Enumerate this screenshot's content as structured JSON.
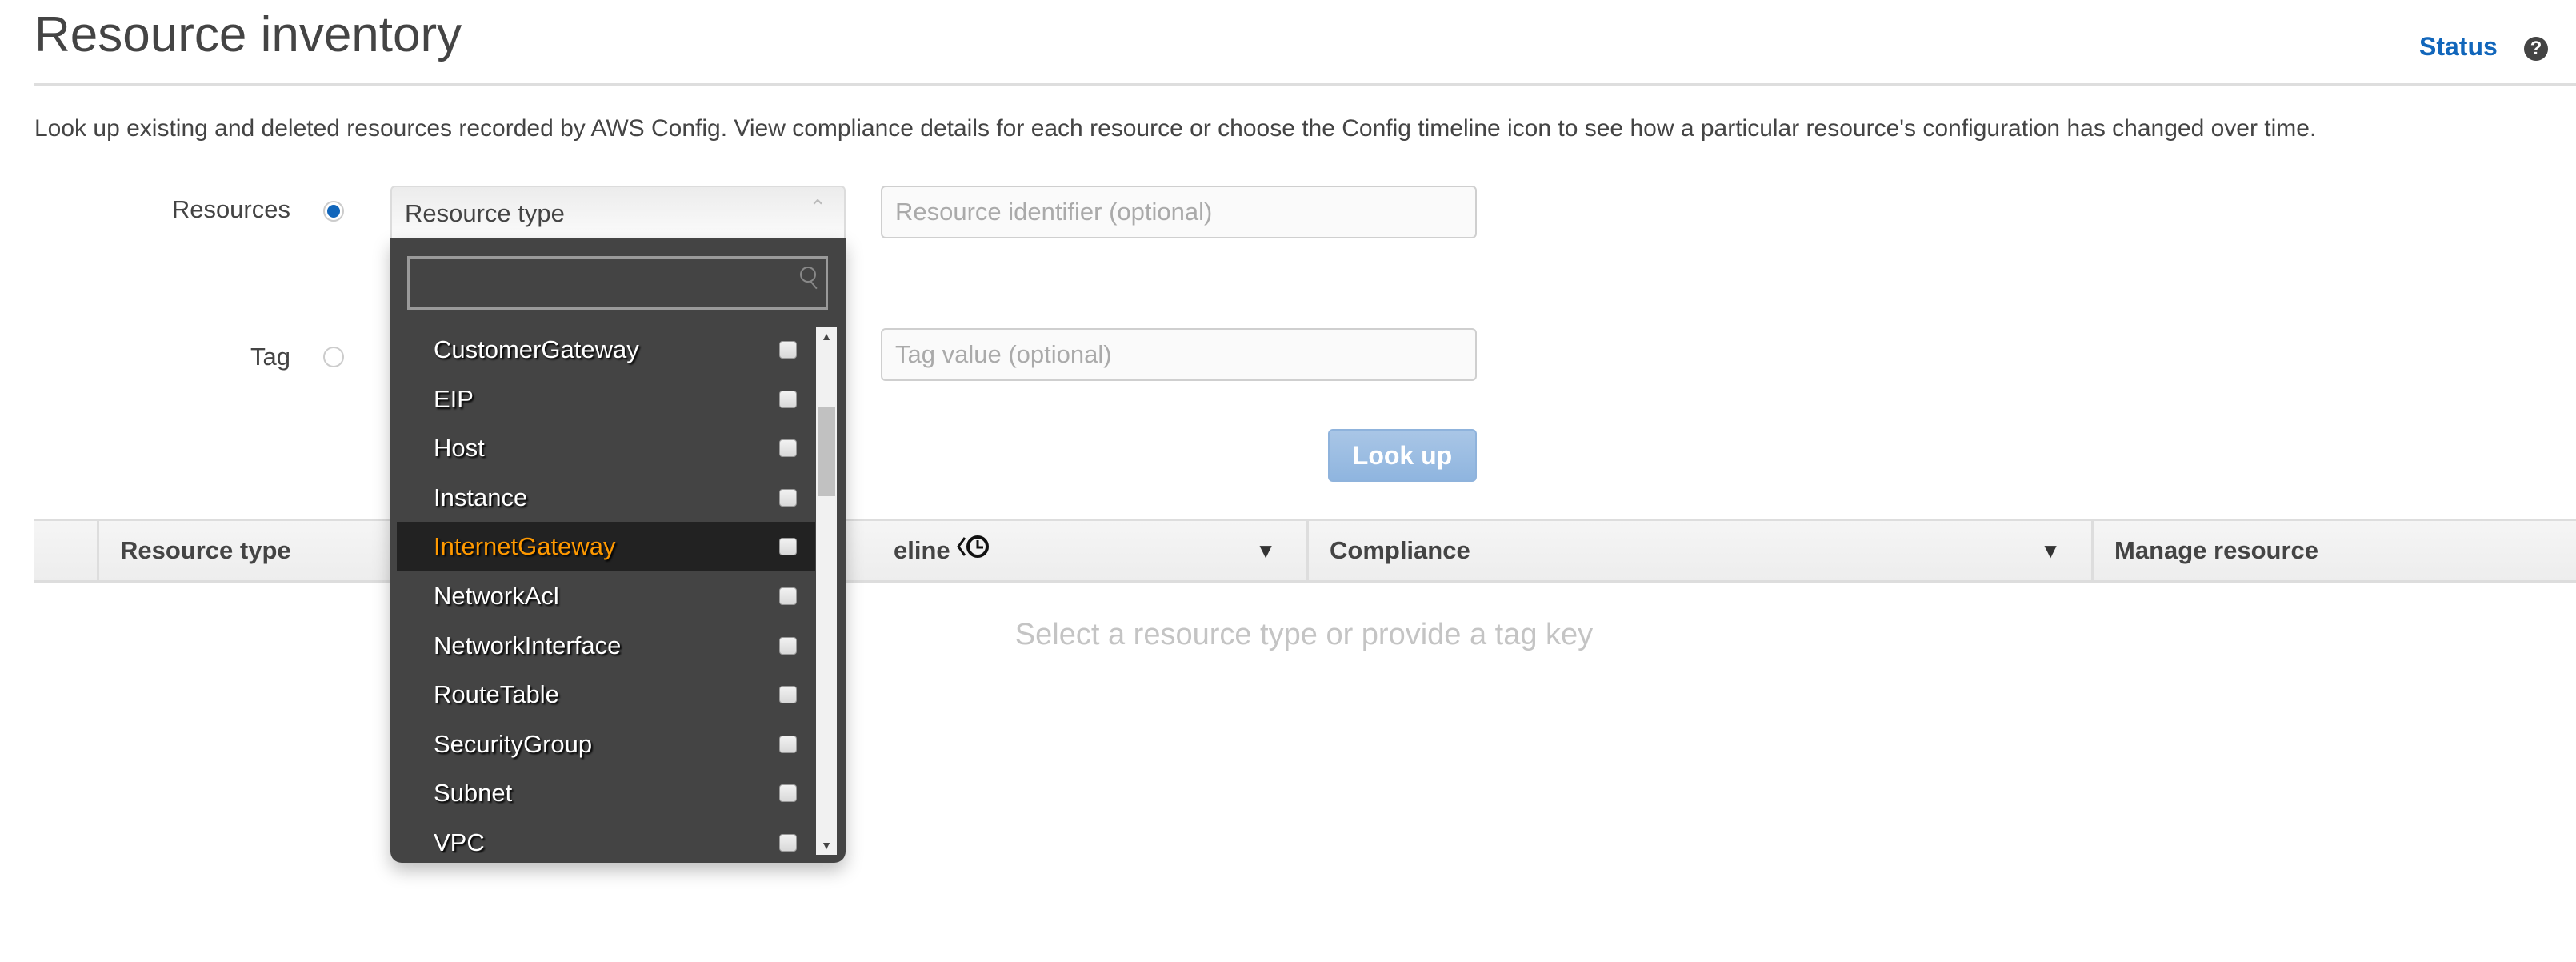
{
  "page": {
    "title": "Resource inventory",
    "status_link": "Status",
    "help_icon": "?",
    "description": "Look up existing and deleted resources recorded by AWS Config. View compliance details for each resource or choose the Config timeline icon to see how a particular resource's configuration has changed over time."
  },
  "form": {
    "resources_label": "Resources",
    "resources_selected": true,
    "tag_label": "Tag",
    "tag_selected": false,
    "resource_type_select": "Resource type",
    "resource_identifier_placeholder": "Resource identifier (optional)",
    "tag_value_placeholder": "Tag value (optional)",
    "lookup_button": "Look up"
  },
  "dropdown": {
    "search_value": "",
    "highlighted": "InternetGateway",
    "items": [
      {
        "label": "CustomerGateway",
        "checked": false
      },
      {
        "label": "EIP",
        "checked": false
      },
      {
        "label": "Host",
        "checked": false
      },
      {
        "label": "Instance",
        "checked": false
      },
      {
        "label": "InternetGateway",
        "checked": false
      },
      {
        "label": "NetworkAcl",
        "checked": false
      },
      {
        "label": "NetworkInterface",
        "checked": false
      },
      {
        "label": "RouteTable",
        "checked": false
      },
      {
        "label": "SecurityGroup",
        "checked": false
      },
      {
        "label": "Subnet",
        "checked": false
      },
      {
        "label": "VPC",
        "checked": false
      }
    ]
  },
  "table": {
    "columns": [
      "Resource type",
      "Config timeline",
      "Compliance",
      "Manage resource"
    ],
    "timeline_partial": "eline",
    "empty_message": "Select a resource type or provide a tag key"
  },
  "colors": {
    "accent": "#1166bb",
    "highlight_text": "#ff9900",
    "dropdown_bg": "#444444",
    "lookup_button": "#9dbde3"
  }
}
